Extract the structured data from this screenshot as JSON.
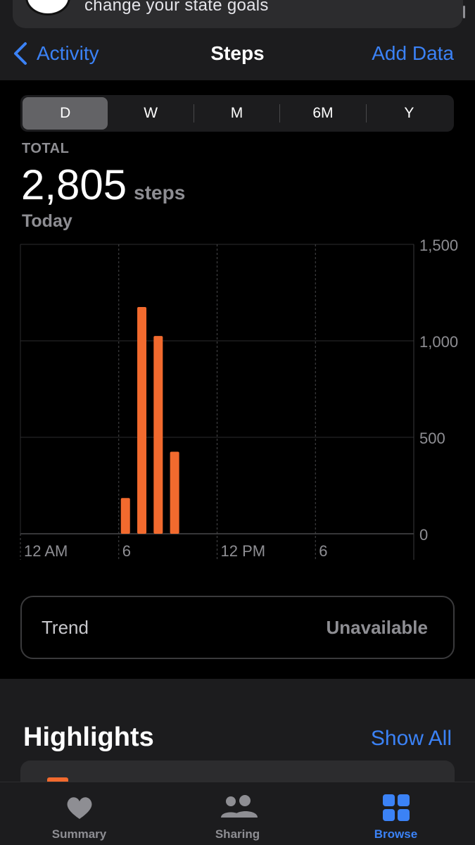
{
  "banner": {
    "text": "change your state goals",
    "icon": "clock-icon"
  },
  "nav": {
    "back_label": "Activity",
    "title": "Steps",
    "action_label": "Add Data"
  },
  "range": {
    "options": [
      "D",
      "W",
      "M",
      "6M",
      "Y"
    ],
    "selected": "D"
  },
  "stats": {
    "total_label": "TOTAL",
    "total_value": "2,805",
    "unit": "steps",
    "period": "Today"
  },
  "chart_data": {
    "type": "bar",
    "x_tick_labels": [
      "12 AM",
      "6",
      "12 PM",
      "6"
    ],
    "y_tick_labels": [
      "1,500",
      "1,000",
      "500",
      "0"
    ],
    "ylim": [
      0,
      1500
    ],
    "hours": [
      6,
      7,
      8,
      9
    ],
    "values": [
      185,
      1175,
      1025,
      425
    ],
    "bar_color": "#f26a2e",
    "grid": true
  },
  "trend": {
    "label": "Trend",
    "value": "Unavailable"
  },
  "highlights": {
    "title": "Highlights",
    "action_label": "Show All"
  },
  "tabbar": {
    "tabs": [
      {
        "label": "Summary",
        "icon": "heart-icon",
        "active": false
      },
      {
        "label": "Sharing",
        "icon": "people-icon",
        "active": false
      },
      {
        "label": "Browse",
        "icon": "grid-icon",
        "active": true
      }
    ]
  },
  "colors": {
    "accent": "#3b82f6",
    "bars": "#f26a2e",
    "background": "#000000"
  }
}
